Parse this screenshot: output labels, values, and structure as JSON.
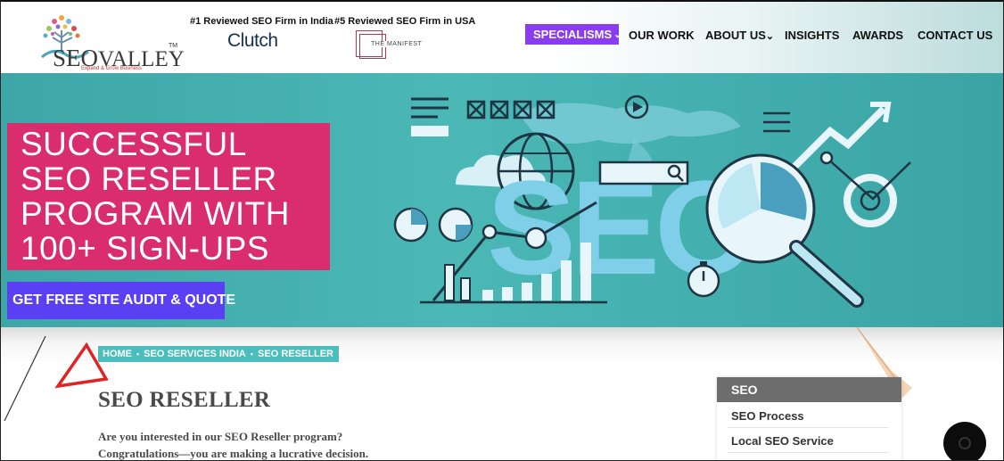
{
  "header": {
    "logo": {
      "brand_main": "SEO",
      "brand_rest": "VALLEY",
      "trademark": "TM",
      "tagline": "Expand & Grow Business"
    },
    "awards": [
      {
        "label": "#1 Reviewed SEO Firm in India",
        "badge": "Clutch"
      },
      {
        "label": "#5 Reviewed SEO Firm in USA",
        "badge": "THE MANIFEST"
      }
    ],
    "nav": {
      "specialisms": "SPECIALISMS",
      "our_work": "OUR WORK",
      "about_us": "ABOUT US",
      "insights": "INSIGHTS",
      "awards": "AWARDS",
      "contact_us": "CONTACT US"
    }
  },
  "hero": {
    "title": "SUCCESSFUL\nSEO RESELLER\nPROGRAM WITH\n100+ SIGN-UPS",
    "cta": "GET FREE SITE AUDIT & QUOTE",
    "art_letters": "SEO"
  },
  "breadcrumb": {
    "items": [
      "HOME",
      "SEO SERVICES INDIA",
      "SEO RESELLER"
    ],
    "separator": "•"
  },
  "content": {
    "title": "SEO RESELLER",
    "intro": "Are you interested in our SEO Reseller program?\nCongratulations—you are making a lucrative decision."
  },
  "sidebar": {
    "heading": "SEO",
    "links": [
      "SEO Process",
      "Local SEO Service"
    ]
  },
  "colors": {
    "accent_purple": "#8a3cf0",
    "cta_blue": "#5b3ff2",
    "hero_pink": "#d92d6e",
    "hero_teal": "#4bb8b6",
    "breadcrumb_teal": "#4bbdbc",
    "sidebar_gray": "#6d6d6d"
  },
  "icons": [
    "logo-tree-icon",
    "chevron-down-icon",
    "seo-illustration",
    "warning-triangle-icon",
    "chat-icon"
  ]
}
